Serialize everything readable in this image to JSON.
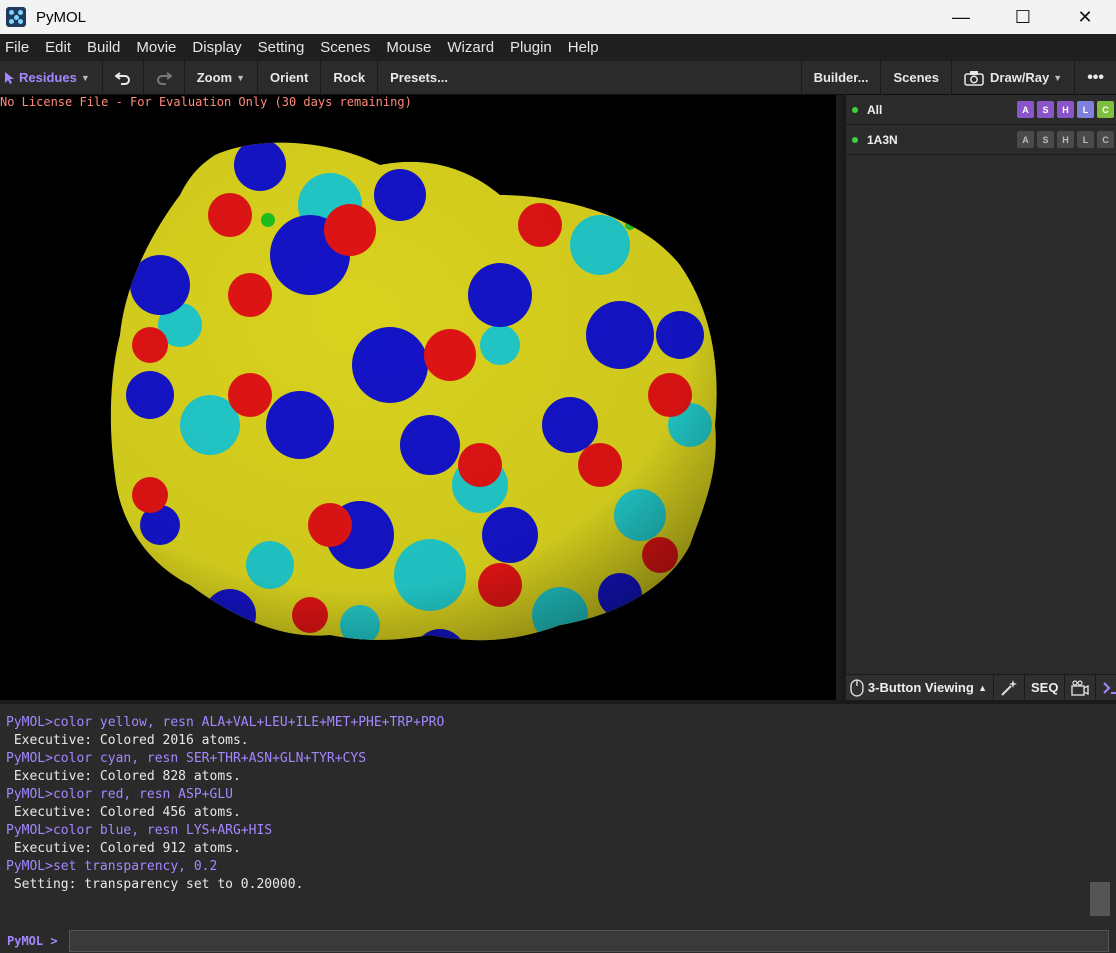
{
  "window": {
    "title": "PyMOL",
    "controls": {
      "minimize": "—",
      "maximize": "☐",
      "close": "✕"
    }
  },
  "menu": [
    "File",
    "Edit",
    "Build",
    "Movie",
    "Display",
    "Setting",
    "Scenes",
    "Mouse",
    "Wizard",
    "Plugin",
    "Help"
  ],
  "toolbar": {
    "selection_mode": "Residues",
    "undo_icon": "undo-icon",
    "redo_icon": "redo-icon",
    "zoom": "Zoom",
    "orient": "Orient",
    "rock": "Rock",
    "presets": "Presets...",
    "builder": "Builder...",
    "scenes": "Scenes",
    "draw_ray": "Draw/Ray",
    "more": "•••"
  },
  "viewport": {
    "license_text": "No License File - For Evaluation Only (30 days remaining)"
  },
  "objects": [
    {
      "name": "All",
      "buttons": [
        "A",
        "S",
        "H",
        "L",
        "C"
      ],
      "colors": [
        "#8a55c9",
        "#8a55c9",
        "#8a55c9",
        "#7f7fdc",
        "#7fbf3f"
      ]
    },
    {
      "name": "1A3N",
      "buttons": [
        "A",
        "S",
        "H",
        "L",
        "C"
      ],
      "colors": [
        "#4a4a4a",
        "#4a4a4a",
        "#4a4a4a",
        "#4a4a4a",
        "#4a4a4a"
      ]
    }
  ],
  "bottom_bar": {
    "mouse_mode": "3-Button Viewing",
    "seq": "SEQ"
  },
  "console": {
    "lines": [
      {
        "type": "cmd",
        "text": "PyMOL>color yellow, resn ALA+VAL+LEU+ILE+MET+PHE+TRP+PRO"
      },
      {
        "type": "out",
        "text": " Executive: Colored 2016 atoms."
      },
      {
        "type": "cmd",
        "text": "PyMOL>color cyan, resn SER+THR+ASN+GLN+TYR+CYS"
      },
      {
        "type": "out",
        "text": " Executive: Colored 828 atoms."
      },
      {
        "type": "cmd",
        "text": "PyMOL>color red, resn ASP+GLU"
      },
      {
        "type": "out",
        "text": " Executive: Colored 456 atoms."
      },
      {
        "type": "cmd",
        "text": "PyMOL>color blue, resn LYS+ARG+HIS"
      },
      {
        "type": "out",
        "text": " Executive: Colored 912 atoms."
      },
      {
        "type": "cmd",
        "text": "PyMOL>set transparency, 0.2"
      },
      {
        "type": "out",
        "text": " Setting: transparency set to 0.20000."
      }
    ],
    "prompt": "PyMOL >",
    "input_value": ""
  }
}
